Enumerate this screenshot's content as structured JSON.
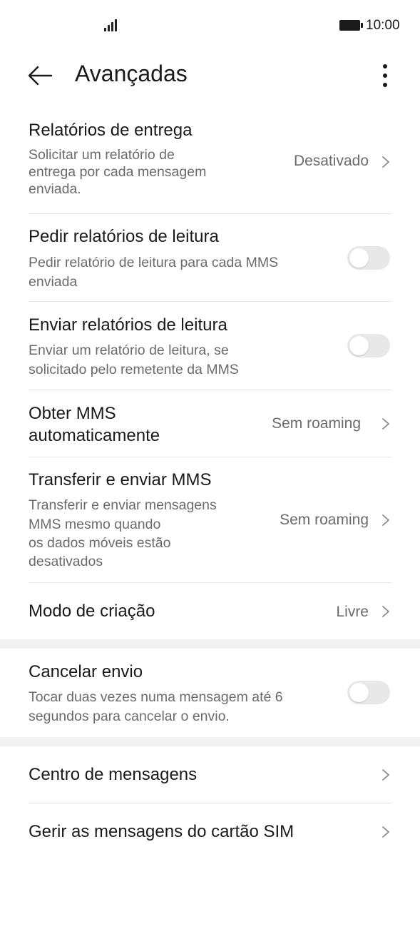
{
  "status_bar": {
    "time": "10:00"
  },
  "header": {
    "title": "Avançadas"
  },
  "settings": {
    "delivery_reports": {
      "title": "Relatórios de entrega",
      "subtitle_lines": [
        "Solicitar um relatório de",
        "entrega por cada mensagem",
        "enviada."
      ],
      "value": "Desativado"
    },
    "request_read_reports": {
      "title": "Pedir relatórios de leitura",
      "subtitle_lines": [
        "Pedir relatório de leitura para cada MMS",
        "enviada"
      ],
      "enabled": false
    },
    "send_read_reports": {
      "title": "Enviar relatórios de leitura",
      "subtitle_lines": [
        "Enviar um relatório de leitura, se",
        "solicitado pelo remetente da MMS"
      ],
      "enabled": false
    },
    "auto_retrieve_mms": {
      "title_lines": [
        "Obter MMS",
        "automaticamente"
      ],
      "value": "Sem roaming"
    },
    "transfer_send_mms": {
      "title": "Transferir e enviar MMS",
      "subtitle_lines": [
        "Transferir e enviar mensagens",
        "MMS mesmo quando",
        "os dados móveis estão",
        "desativados"
      ],
      "value": "Sem roaming"
    },
    "creation_mode": {
      "title": "Modo de criação",
      "value": "Livre"
    },
    "cancel_send": {
      "title": "Cancelar envio",
      "subtitle_lines": [
        "Tocar duas vezes numa mensagem até 6",
        "segundos para cancelar o envio."
      ],
      "enabled": false
    },
    "message_center": {
      "title": "Centro de mensagens"
    },
    "sim_messages": {
      "title": "Gerir as mensagens do cartão SIM"
    }
  }
}
